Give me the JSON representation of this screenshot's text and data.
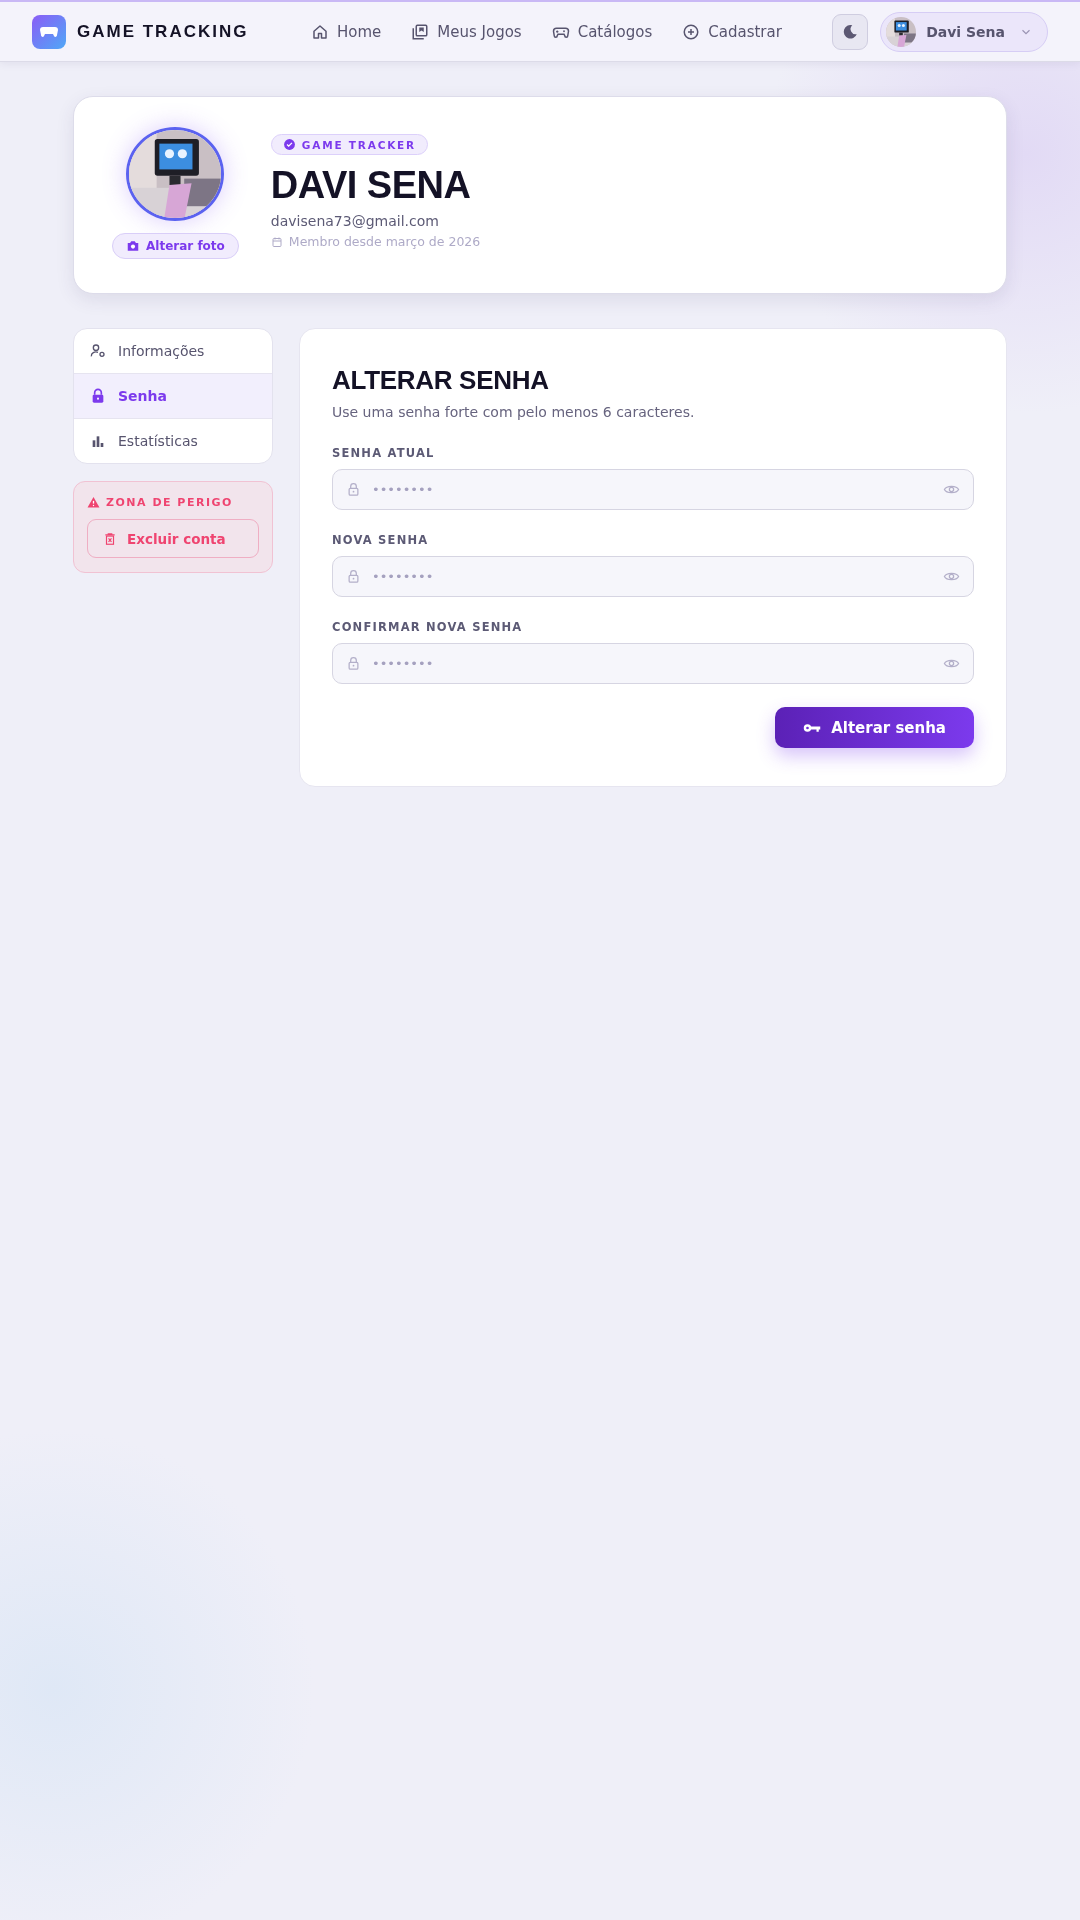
{
  "header": {
    "brand": "GAME TRACKING",
    "nav": [
      {
        "label": "Home",
        "selected": false
      },
      {
        "label": "Meus Jogos",
        "selected": false
      },
      {
        "label": "Catálogos",
        "selected": false
      },
      {
        "label": "Cadastrar",
        "selected": false
      }
    ],
    "user": {
      "name": "Davi Sena"
    }
  },
  "profile": {
    "badge": "GAME TRACKER",
    "name": "DAVI SENA",
    "email": "davisena73@gmail.com",
    "member_since": "Membro desde março de 2026",
    "change_photo": "Alterar foto"
  },
  "sidebar": {
    "items": [
      {
        "label": "Informações",
        "selected": false
      },
      {
        "label": "Senha",
        "selected": true
      },
      {
        "label": "Estatísticas",
        "selected": false
      }
    ],
    "danger": {
      "title": "ZONA DE PERIGO",
      "button": "Excluir conta"
    }
  },
  "form": {
    "title": "ALTERAR SENHA",
    "subtitle": "Use uma senha forte com pelo menos 6 caracteres.",
    "fields": [
      {
        "label": "SENHA ATUAL",
        "placeholder": "••••••••"
      },
      {
        "label": "NOVA SENHA",
        "placeholder": "••••••••"
      },
      {
        "label": "CONFIRMAR NOVA SENHA",
        "placeholder": "••••••••"
      }
    ],
    "submit": "Alterar senha"
  }
}
